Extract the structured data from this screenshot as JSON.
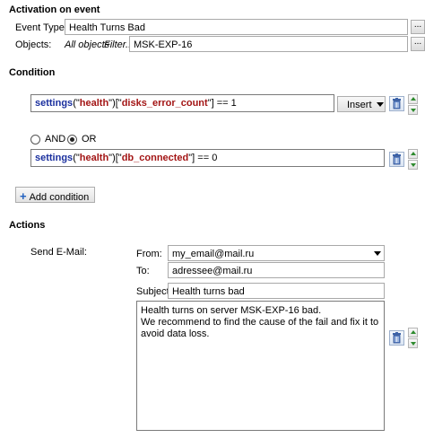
{
  "activation": {
    "title": "Activation on event",
    "event_types_label": "Event Types:",
    "event_types_value": "Health Turns Bad",
    "objects_label": "Objects:",
    "objects_all": "All objects",
    "objects_filter": "Filter...",
    "objects_value": "MSK-EXP-16",
    "browse_label": "..."
  },
  "condition": {
    "title": "Condition",
    "cond1": {
      "fn": "settings",
      "p1": "(\"",
      "key1": "health",
      "p2": "\")[\"",
      "key2": "disks_error_count",
      "p3": "\"] == 1"
    },
    "cond2": {
      "fn": "settings",
      "p1": "(\"",
      "key1": "health",
      "p2": "\")[\"",
      "key2": "db_connected",
      "p3": "\"] == 0"
    },
    "insert_label": "Insert",
    "and_label": "AND",
    "or_label": "OR",
    "selected_operator": "OR",
    "add_condition_label": "Add condition"
  },
  "actions": {
    "title": "Actions",
    "send_email_label": "Send E-Mail:",
    "from_label": "From:",
    "from_value": "my_email@mail.ru",
    "to_label": "To:",
    "to_value": "adressee@mail.ru",
    "subject_label": "Subject:",
    "subject_value": "Health turns bad",
    "body_value": "Health turns on server MSK-EXP-16 bad.\nWe recommend to find the cause of the fail and fix it to avoid data loss."
  },
  "colors": {
    "keyword": "#1a2f9e",
    "string": "#a31515",
    "arrow": "#2e8b2e"
  },
  "icons": [
    "trash-icon",
    "arrow-up-icon",
    "arrow-down-icon",
    "plus-icon",
    "dropdown-arrow-icon"
  ]
}
